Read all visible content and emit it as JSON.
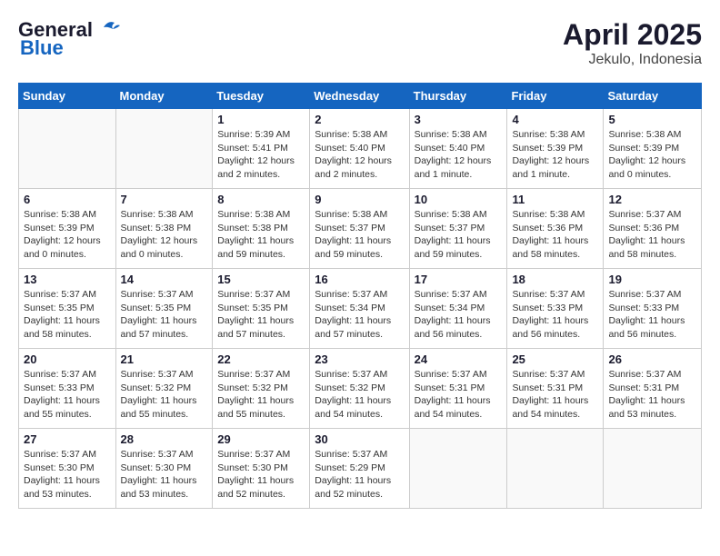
{
  "header": {
    "logo_line1": "General",
    "logo_line2": "Blue",
    "month": "April 2025",
    "location": "Jekulo, Indonesia"
  },
  "days_of_week": [
    "Sunday",
    "Monday",
    "Tuesday",
    "Wednesday",
    "Thursday",
    "Friday",
    "Saturday"
  ],
  "weeks": [
    [
      {
        "day": null
      },
      {
        "day": null
      },
      {
        "day": "1",
        "sunrise": "Sunrise: 5:39 AM",
        "sunset": "Sunset: 5:41 PM",
        "daylight": "Daylight: 12 hours and 2 minutes."
      },
      {
        "day": "2",
        "sunrise": "Sunrise: 5:38 AM",
        "sunset": "Sunset: 5:40 PM",
        "daylight": "Daylight: 12 hours and 2 minutes."
      },
      {
        "day": "3",
        "sunrise": "Sunrise: 5:38 AM",
        "sunset": "Sunset: 5:40 PM",
        "daylight": "Daylight: 12 hours and 1 minute."
      },
      {
        "day": "4",
        "sunrise": "Sunrise: 5:38 AM",
        "sunset": "Sunset: 5:39 PM",
        "daylight": "Daylight: 12 hours and 1 minute."
      },
      {
        "day": "5",
        "sunrise": "Sunrise: 5:38 AM",
        "sunset": "Sunset: 5:39 PM",
        "daylight": "Daylight: 12 hours and 0 minutes."
      }
    ],
    [
      {
        "day": "6",
        "sunrise": "Sunrise: 5:38 AM",
        "sunset": "Sunset: 5:39 PM",
        "daylight": "Daylight: 12 hours and 0 minutes."
      },
      {
        "day": "7",
        "sunrise": "Sunrise: 5:38 AM",
        "sunset": "Sunset: 5:38 PM",
        "daylight": "Daylight: 12 hours and 0 minutes."
      },
      {
        "day": "8",
        "sunrise": "Sunrise: 5:38 AM",
        "sunset": "Sunset: 5:38 PM",
        "daylight": "Daylight: 11 hours and 59 minutes."
      },
      {
        "day": "9",
        "sunrise": "Sunrise: 5:38 AM",
        "sunset": "Sunset: 5:37 PM",
        "daylight": "Daylight: 11 hours and 59 minutes."
      },
      {
        "day": "10",
        "sunrise": "Sunrise: 5:38 AM",
        "sunset": "Sunset: 5:37 PM",
        "daylight": "Daylight: 11 hours and 59 minutes."
      },
      {
        "day": "11",
        "sunrise": "Sunrise: 5:38 AM",
        "sunset": "Sunset: 5:36 PM",
        "daylight": "Daylight: 11 hours and 58 minutes."
      },
      {
        "day": "12",
        "sunrise": "Sunrise: 5:37 AM",
        "sunset": "Sunset: 5:36 PM",
        "daylight": "Daylight: 11 hours and 58 minutes."
      }
    ],
    [
      {
        "day": "13",
        "sunrise": "Sunrise: 5:37 AM",
        "sunset": "Sunset: 5:35 PM",
        "daylight": "Daylight: 11 hours and 58 minutes."
      },
      {
        "day": "14",
        "sunrise": "Sunrise: 5:37 AM",
        "sunset": "Sunset: 5:35 PM",
        "daylight": "Daylight: 11 hours and 57 minutes."
      },
      {
        "day": "15",
        "sunrise": "Sunrise: 5:37 AM",
        "sunset": "Sunset: 5:35 PM",
        "daylight": "Daylight: 11 hours and 57 minutes."
      },
      {
        "day": "16",
        "sunrise": "Sunrise: 5:37 AM",
        "sunset": "Sunset: 5:34 PM",
        "daylight": "Daylight: 11 hours and 57 minutes."
      },
      {
        "day": "17",
        "sunrise": "Sunrise: 5:37 AM",
        "sunset": "Sunset: 5:34 PM",
        "daylight": "Daylight: 11 hours and 56 minutes."
      },
      {
        "day": "18",
        "sunrise": "Sunrise: 5:37 AM",
        "sunset": "Sunset: 5:33 PM",
        "daylight": "Daylight: 11 hours and 56 minutes."
      },
      {
        "day": "19",
        "sunrise": "Sunrise: 5:37 AM",
        "sunset": "Sunset: 5:33 PM",
        "daylight": "Daylight: 11 hours and 56 minutes."
      }
    ],
    [
      {
        "day": "20",
        "sunrise": "Sunrise: 5:37 AM",
        "sunset": "Sunset: 5:33 PM",
        "daylight": "Daylight: 11 hours and 55 minutes."
      },
      {
        "day": "21",
        "sunrise": "Sunrise: 5:37 AM",
        "sunset": "Sunset: 5:32 PM",
        "daylight": "Daylight: 11 hours and 55 minutes."
      },
      {
        "day": "22",
        "sunrise": "Sunrise: 5:37 AM",
        "sunset": "Sunset: 5:32 PM",
        "daylight": "Daylight: 11 hours and 55 minutes."
      },
      {
        "day": "23",
        "sunrise": "Sunrise: 5:37 AM",
        "sunset": "Sunset: 5:32 PM",
        "daylight": "Daylight: 11 hours and 54 minutes."
      },
      {
        "day": "24",
        "sunrise": "Sunrise: 5:37 AM",
        "sunset": "Sunset: 5:31 PM",
        "daylight": "Daylight: 11 hours and 54 minutes."
      },
      {
        "day": "25",
        "sunrise": "Sunrise: 5:37 AM",
        "sunset": "Sunset: 5:31 PM",
        "daylight": "Daylight: 11 hours and 54 minutes."
      },
      {
        "day": "26",
        "sunrise": "Sunrise: 5:37 AM",
        "sunset": "Sunset: 5:31 PM",
        "daylight": "Daylight: 11 hours and 53 minutes."
      }
    ],
    [
      {
        "day": "27",
        "sunrise": "Sunrise: 5:37 AM",
        "sunset": "Sunset: 5:30 PM",
        "daylight": "Daylight: 11 hours and 53 minutes."
      },
      {
        "day": "28",
        "sunrise": "Sunrise: 5:37 AM",
        "sunset": "Sunset: 5:30 PM",
        "daylight": "Daylight: 11 hours and 53 minutes."
      },
      {
        "day": "29",
        "sunrise": "Sunrise: 5:37 AM",
        "sunset": "Sunset: 5:30 PM",
        "daylight": "Daylight: 11 hours and 52 minutes."
      },
      {
        "day": "30",
        "sunrise": "Sunrise: 5:37 AM",
        "sunset": "Sunset: 5:29 PM",
        "daylight": "Daylight: 11 hours and 52 minutes."
      },
      {
        "day": null
      },
      {
        "day": null
      },
      {
        "day": null
      }
    ]
  ]
}
